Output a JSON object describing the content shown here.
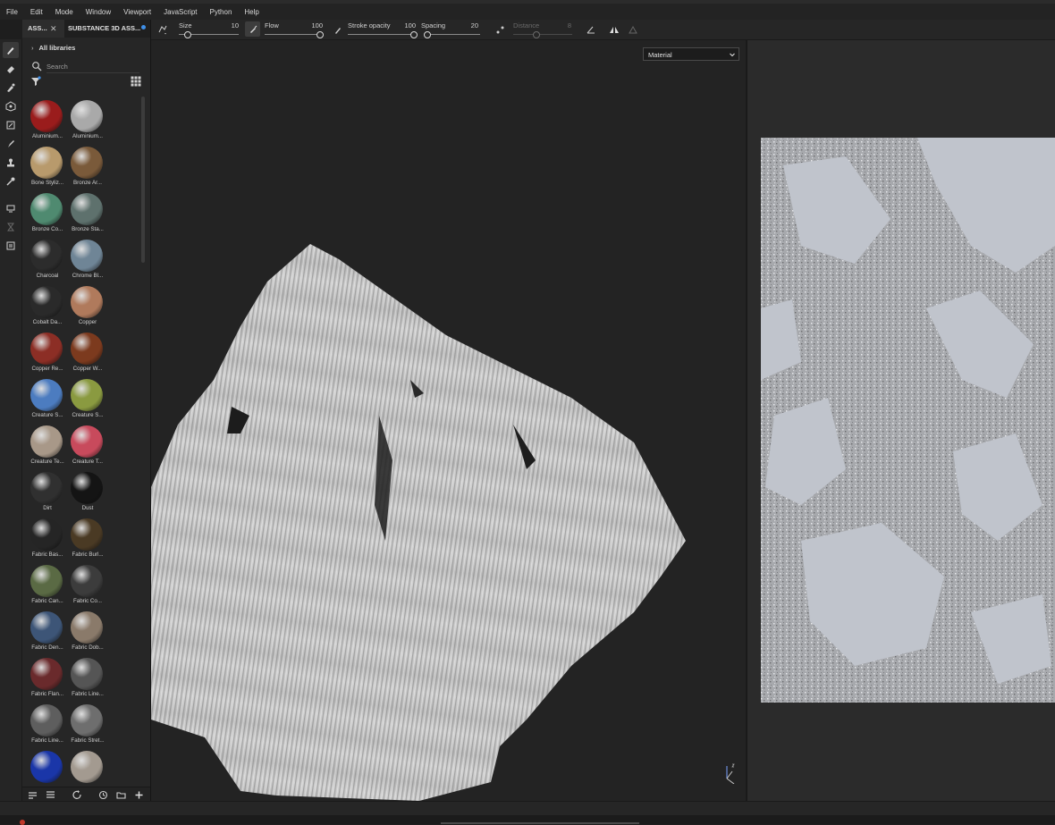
{
  "menu": [
    "File",
    "Edit",
    "Mode",
    "Window",
    "Viewport",
    "JavaScript",
    "Python",
    "Help"
  ],
  "tools": [
    "paint-brush-icon",
    "eraser-icon",
    "projection-icon",
    "geometry-mask-icon",
    "polygon-fill-icon",
    "smudge-icon",
    "clone-stamp-icon",
    "color-picker-icon",
    "bake-icon",
    "hourglass-icon",
    "layer-assign-icon"
  ],
  "panel": {
    "tab_assets": "ASS...",
    "tab_close": "✕",
    "tab_substance": "SUBSTANCE 3D ASS...",
    "all_libraries": "All libraries",
    "search_placeholder": "Search"
  },
  "materials": [
    {
      "label": "Aluminium...",
      "color": "#9a1c1c"
    },
    {
      "label": "Aluminium...",
      "color": "#a9a9a9"
    },
    {
      "label": "Bone Styliz...",
      "color": "#b89a6c"
    },
    {
      "label": "Bronze Ar...",
      "color": "#7a5a3a"
    },
    {
      "label": "Bronze Co...",
      "color": "#4f8a70"
    },
    {
      "label": "Bronze Sta...",
      "color": "#5e716d"
    },
    {
      "label": "Charcoal",
      "color": "#2c2c2c"
    },
    {
      "label": "Chrome Bl...",
      "color": "#6f8596"
    },
    {
      "label": "Cobalt Da...",
      "color": "#2a2a2a"
    },
    {
      "label": "Copper",
      "color": "#b07a5c"
    },
    {
      "label": "Copper Re...",
      "color": "#8c2e25"
    },
    {
      "label": "Copper W...",
      "color": "#7c3a1e"
    },
    {
      "label": "Creature S...",
      "color": "#4c7cc0"
    },
    {
      "label": "Creature S...",
      "color": "#8a9a40"
    },
    {
      "label": "Creature Te...",
      "color": "#a89888"
    },
    {
      "label": "Creature T...",
      "color": "#c84a5c"
    },
    {
      "label": "Dirt",
      "color": "#303030"
    },
    {
      "label": "Dust",
      "color": "#141414"
    },
    {
      "label": "Fabric Bas...",
      "color": "#252525"
    },
    {
      "label": "Fabric Burl...",
      "color": "#4a3a24"
    },
    {
      "label": "Fabric Can...",
      "color": "#5a6a44"
    },
    {
      "label": "Fabric Co...",
      "color": "#3c3c3c"
    },
    {
      "label": "Fabric Den...",
      "color": "#3d5577"
    },
    {
      "label": "Fabric Dob...",
      "color": "#8a7a6a"
    },
    {
      "label": "Fabric Flan...",
      "color": "#6a2a2c"
    },
    {
      "label": "Fabric Line...",
      "color": "#555555"
    },
    {
      "label": "Fabric Line...",
      "color": "#5e5e5e"
    },
    {
      "label": "Fabric Stret...",
      "color": "#6e6e6e"
    },
    {
      "label": "",
      "color": "#1a36a8"
    },
    {
      "label": "",
      "color": "#a39a90"
    }
  ],
  "options": {
    "size_label": "Size",
    "size_value": "10",
    "size_fraction": 0.15,
    "flow_label": "Flow",
    "flow_value": "100",
    "flow_fraction": 1.0,
    "opacity_label": "Stroke opacity",
    "opacity_value": "100",
    "opacity_fraction": 1.0,
    "spacing_label": "Spacing",
    "spacing_value": "20",
    "spacing_fraction": 0.05,
    "distance_label": "Distance",
    "distance_value": "8",
    "distance_fraction": 0.4
  },
  "viewport": {
    "channel_select": "Material"
  }
}
